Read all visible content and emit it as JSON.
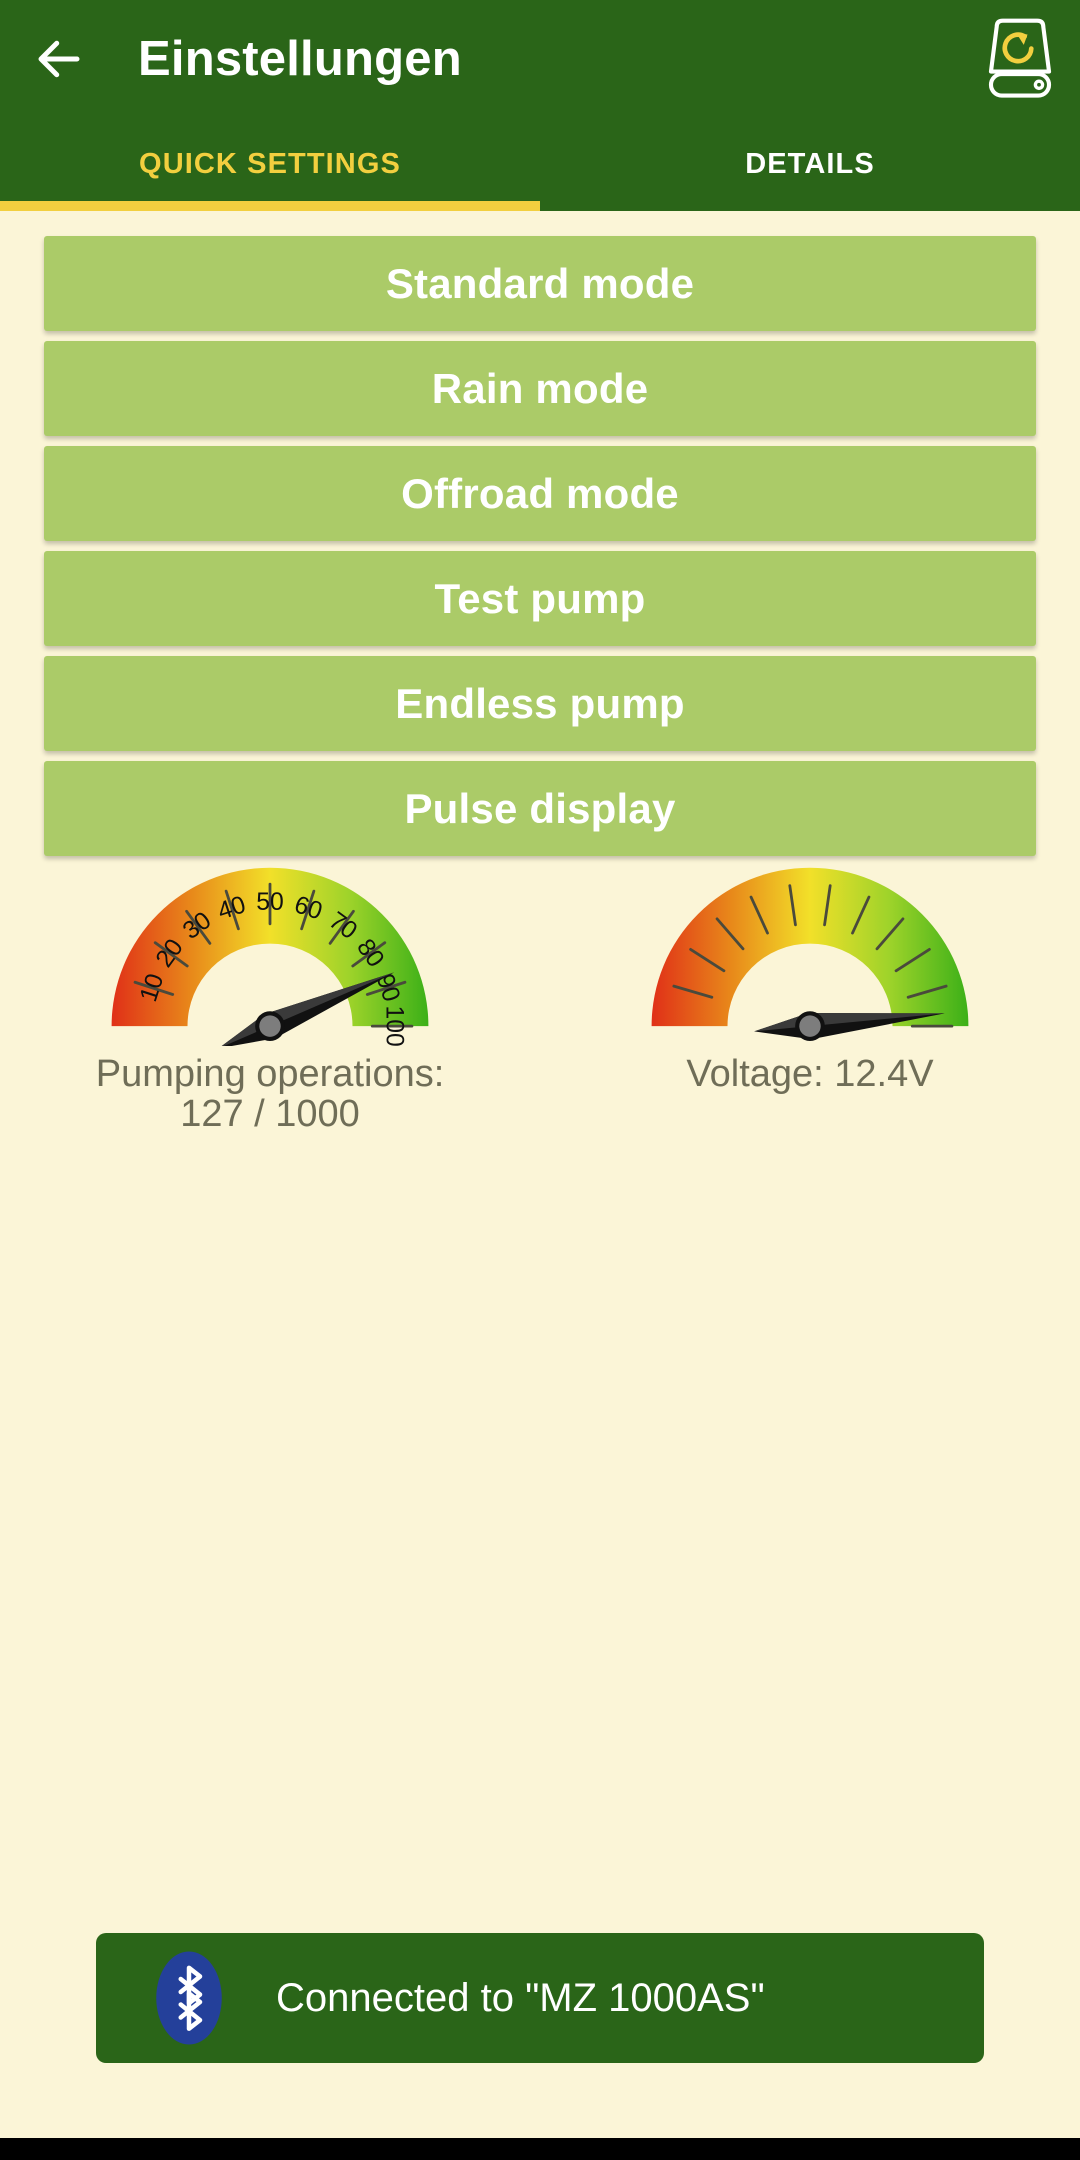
{
  "theme": {
    "header_green": "#2a6518",
    "accent_yellow": "#f2cf3f",
    "button_green": "#abcb68",
    "page_background": "#fbf5d7",
    "caption_gray": "#6f6d57",
    "bluetooth_blue": "#24409a"
  },
  "appbar": {
    "back_icon": "arrow-left-icon",
    "title": "Einstellungen",
    "action_icon": "device-reset-icon"
  },
  "tabs": [
    {
      "label": "QUICK SETTINGS",
      "active": true
    },
    {
      "label": "DETAILS",
      "active": false
    }
  ],
  "buttons": [
    {
      "label": "Standard mode"
    },
    {
      "label": "Rain mode"
    },
    {
      "label": "Offroad mode"
    },
    {
      "label": "Test pump"
    },
    {
      "label": "Endless pump"
    },
    {
      "label": "Pulse display"
    }
  ],
  "gauges": [
    {
      "name": "pumping-operations-gauge",
      "caption_line1": "Pumping operations:",
      "caption_line2": "127 / 1000",
      "value": 127,
      "max": 1000,
      "percent": 87,
      "show_numbers": true,
      "tick_labels": [
        "10",
        "20",
        "30",
        "40",
        "50",
        "60",
        "70",
        "80",
        "90",
        "100"
      ]
    },
    {
      "name": "voltage-gauge",
      "caption_line1": "Voltage: 12.4V",
      "caption_line2": "",
      "value": 12.4,
      "unit": "V",
      "percent": 97,
      "show_numbers": false,
      "tick_labels": []
    }
  ],
  "status": {
    "icon": "bluetooth-icon",
    "text": "Connected to \"MZ 1000AS\""
  },
  "chart_data": [
    {
      "type": "gauge",
      "title": "Pumping operations",
      "value": 127,
      "display_value": "127 / 1000",
      "min": 0,
      "max": 100,
      "needle_percent": 87,
      "tick_labels": [
        "10",
        "20",
        "30",
        "40",
        "50",
        "60",
        "70",
        "80",
        "90",
        "100"
      ],
      "major_ticks": 10,
      "color_scale": [
        "#e03018",
        "#e8881a",
        "#f2e029",
        "#9ed32a",
        "#3cb018"
      ],
      "grid": false,
      "legend": "none"
    },
    {
      "type": "gauge",
      "title": "Voltage",
      "value": 12.4,
      "display_value": "12.4V",
      "min": 0,
      "max": 100,
      "needle_percent": 97,
      "tick_labels": [],
      "major_ticks": 11,
      "color_scale": [
        "#e03018",
        "#e8881a",
        "#f2e029",
        "#9ed32a",
        "#3cb018"
      ],
      "grid": false,
      "legend": "none"
    }
  ]
}
